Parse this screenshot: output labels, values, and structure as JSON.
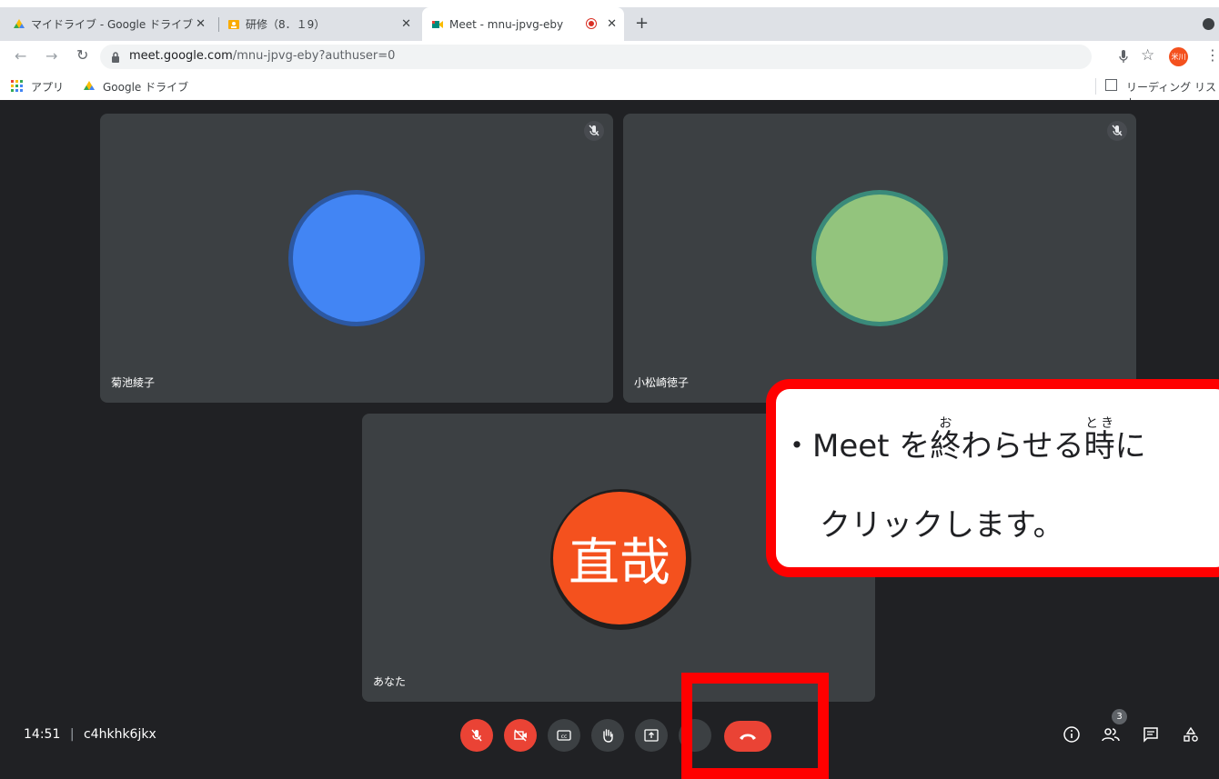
{
  "browser": {
    "tabs": [
      {
        "label": "マイドライブ - Google ドライブ",
        "close": "✕"
      },
      {
        "label": "研修（8．１9）",
        "close": "✕"
      },
      {
        "label": "Meet - mnu-jpvg-eby",
        "close": "✕"
      }
    ],
    "new_tab": "+",
    "url_host": "meet.google.com",
    "url_path": "/mnu-jpvg-eby?authuser=0",
    "profile_initials": "米川",
    "bookmarks": {
      "apps": "アプリ",
      "drive": "Google ドライブ",
      "reading_list": "リーディング リスト"
    }
  },
  "meeting": {
    "participants": [
      {
        "name": "菊池綾子",
        "avatar_color": "#4285f4",
        "ring_color": "#2c58a3"
      },
      {
        "name": "小松崎徳子",
        "avatar_color": "#93c47d",
        "ring_color": "#3a8a7a"
      },
      {
        "name": "あなた",
        "avatar_text": "直哉",
        "avatar_color": "#f4511e"
      }
    ],
    "time": "14:51",
    "separator": "|",
    "meeting_code": "c4hkhk6jkx",
    "participant_count": "3"
  },
  "callout": {
    "bullet": "・",
    "line1_prefix": "Meet を",
    "ruby1_base": "終",
    "ruby1_reading": "お",
    "line1_mid": "わらせる",
    "ruby2_base": "時",
    "ruby2_reading": "とき",
    "line1_suffix": "に",
    "line2": "クリックします。"
  },
  "colors": {
    "stage_bg": "#202124",
    "tile_bg": "#3c4043",
    "danger_red": "#ea4335",
    "callout_red": "#ff0000"
  }
}
